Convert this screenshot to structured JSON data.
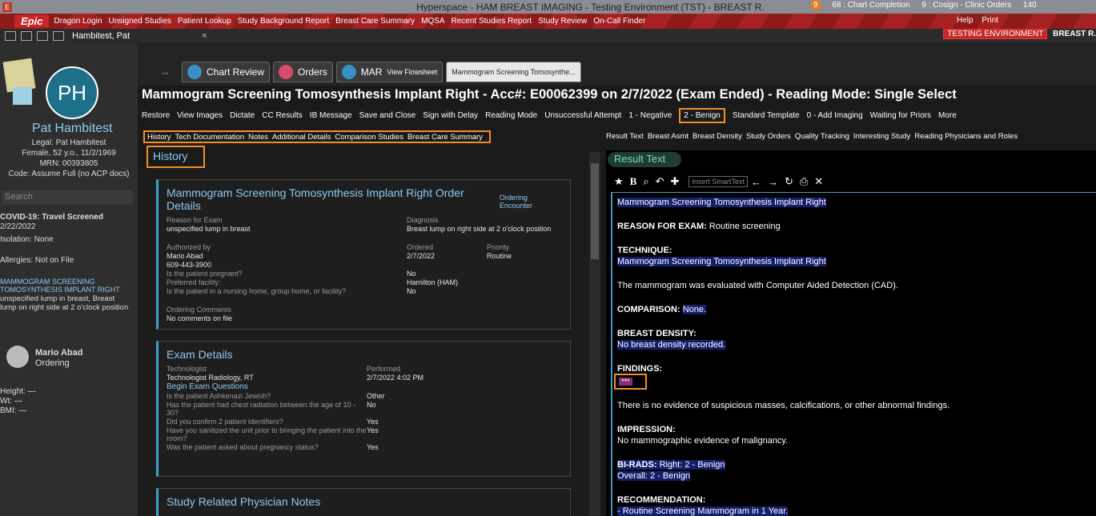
{
  "titlebar": {
    "title": "Hyperspace - HAM BREAST IMAGING - Testing Environment (TST) - BREAST R.",
    "badge": "9",
    "chart_completion": "68 : Chart Completion",
    "cosign": "9 : Cosign - Clinic Orders",
    "count": "140"
  },
  "epic": {
    "logo": "Epic",
    "items": [
      "Dragon Login",
      "Unsigned Studies",
      "Patient Lookup",
      "Study Background Report",
      "Breast Care Summary",
      "MQSA",
      "Recent Studies Report",
      "Study Review",
      "On-Call Finder"
    ],
    "help": "Help",
    "print": "Print"
  },
  "tabbar": {
    "patient_tab": "Hambitest, Pat",
    "close": "×",
    "env": "TESTING ENVIRONMENT",
    "user": "BREAST R."
  },
  "patient": {
    "initials": "PH",
    "name": "Pat Hambitest",
    "legal": "Legal: Pat Hambitest",
    "demo": "Female, 52 y.o., 11/2/1969",
    "mrn": "MRN: 00393805",
    "code": "Code: Assume Full (no ACP docs)",
    "search_placeholder": "Search",
    "covid": "COVID-19: Travel Screened",
    "covid_date": "2/22/2022",
    "isolation": "Isolation: None",
    "allergies": "Allergies: Not on File",
    "order_title": "MAMMOGRAM SCREENING TOMOSYNTHESIS IMPLANT RIGHT",
    "order_desc": "unspecified lump in breast, Breast lump on right side at 2 o'clock position",
    "provider": "Mario Abad",
    "provider_role": "Ordering",
    "height": "Height: —",
    "wt": "Wt: —",
    "bmi": "BMI: —"
  },
  "nav": {
    "chart_review": "Chart Review",
    "orders": "Orders",
    "mar": "MAR",
    "flowsheet": "View Flowsheet",
    "active_tab": "Mammogram Screening Tomosynthe..."
  },
  "headline": "Mammogram Screening Tomosynthesis Implant Right - Acc#: E00062399 on 2/7/2022 (Exam Ended) - Reading Mode: Single Select",
  "toolbar": [
    "Restore",
    "View Images",
    "Dictate",
    "CC Results",
    "IB Message",
    "Save and Close",
    "Sign with Delay",
    "Reading Mode",
    "Unsuccessful Attempt",
    "1 - Negative",
    "2 - Benign",
    "Standard Template",
    "0 - Add Imaging",
    "Waiting for Priors",
    "More"
  ],
  "subnav": [
    "History",
    "Tech Documentation",
    "Notes",
    "Additional Details",
    "Comparison Studies",
    "Breast Care Summary"
  ],
  "rsubnav": [
    "Result Text",
    "Breast Asmt",
    "Breast Density",
    "Study Orders",
    "Quality Tracking",
    "Interesting Study",
    "Reading Physicians and Roles"
  ],
  "history_title": "History",
  "order_card": {
    "title": "Mammogram Screening Tomosynthesis Implant Right Order Details",
    "link": "Ordering Encounter",
    "reason_l": "Reason for Exam",
    "reason_v": "unspecified lump in breast",
    "diag_l": "Diagnosis",
    "diag_v": "Breast lump on right side at 2 o'clock position",
    "auth_l": "Authorized by",
    "auth_v": "Mario Abad",
    "phone": "609-443-3900",
    "ordered_l": "Ordered",
    "ordered_v": "2/7/2022",
    "prio_l": "Priority",
    "prio_v": "Routine",
    "q1": "Is the patient pregnant?",
    "a1": "No",
    "q2": "Preferred facility:",
    "a2": "Hamilton (HAM)",
    "q3": "Is the patient in a nursing home, group home, or facility?",
    "a3": "No",
    "comments_l": "Ordering Comments",
    "comments_v": "No comments on file"
  },
  "exam_card": {
    "title": "Exam Details",
    "tech_l": "Technologist",
    "tech_v": "Technologist Radiology, RT",
    "perf_l": "Performed",
    "perf_v": "2/7/2022 4:02 PM",
    "begin": "Begin Exam Questions",
    "q1": "Is the patient Ashkenazi Jewish?",
    "a1": "Other",
    "q2": "Has the patient had chest radiation between the age of 10 - 30?",
    "a2": "No",
    "q3": "Did you confirm 2 patient identifiers?",
    "a3": "Yes",
    "q4": "Have you sanitized the unit prior to bringing the patient into the room?",
    "a4": "Yes",
    "q5": "Was the patient asked about pregnancy status?",
    "a5": "Yes"
  },
  "notes_card": {
    "title": "Study Related Physician Notes"
  },
  "result": {
    "title": "Result Text",
    "smarttext": "Insert SmartText",
    "l1": "Mammogram Screening Tomosynthesis Implant Right",
    "reason_h": "REASON FOR EXAM:",
    "reason_v": "Routine screening",
    "tech_h": "TECHNIQUE:",
    "tech_v": "Mammogram Screening Tomosynthesis Implant Right",
    "cad": "The mammogram was evaluated with Computer Aided Detection (CAD).",
    "comp_h": "COMPARISON:",
    "comp_v": "None.",
    "dens_h": "BREAST DENSITY:",
    "dens_v": "No breast density recorded.",
    "find_h": "FINDINGS:",
    "marker": "***",
    "find_v": "There is no evidence of suspicious masses, calcifications, or other abnormal findings.",
    "imp_h": "IMPRESSION:",
    "imp_v": "No mammographic evidence of malignancy.",
    "birads_h": "BI-RADS:",
    "birads_v": "Right: 2 - Benign",
    "overall": "Overall: 2 - Benign",
    "rec_h": "RECOMMENDATION:",
    "rec_v": "- Routine Screening Mammogram in 1 Year."
  }
}
